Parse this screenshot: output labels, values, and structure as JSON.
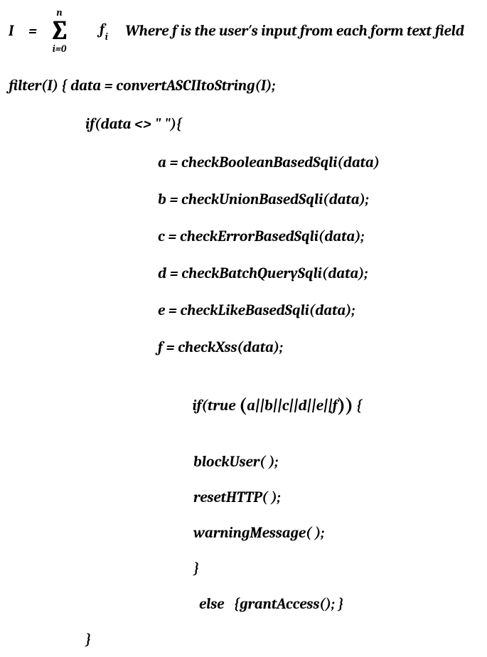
{
  "eq": {
    "lhs": "I ",
    "eq": " = ",
    "sigma_top": "n",
    "sigma_bot": "i=0",
    "f": "f",
    "f_sub": "i",
    "where": "Where f is the user′s input from each form text field"
  },
  "code": {
    "l_filter": "filter(I) { data = convertASCIItoString(I);",
    "l_ifdata": "if(data <> \" \"){",
    "l_a": "a = checkBooleanBasedSqli(data)",
    "l_b": "b = checkUnionBasedSqli(data);",
    "l_c": "c = checkErrorBasedSqli(data);",
    "l_d": "d = checkBatchQuerySqli(data);",
    "l_e": "e = checkLikeBasedSqli(data);",
    "l_f": "f = checkXss(data);",
    "l_iftrue_pre": "if(true ",
    "l_iftrue_cond": "a||b||c||d||e||f",
    "l_iftrue_post": "{",
    "l_block": "blockUser( );",
    "l_reset": "resetHTTP( );",
    "l_warn": "warningMessage( );",
    "l_closeinner": "}",
    "l_else": "else   {grantAccess(); }",
    "l_closeouter": "}"
  }
}
